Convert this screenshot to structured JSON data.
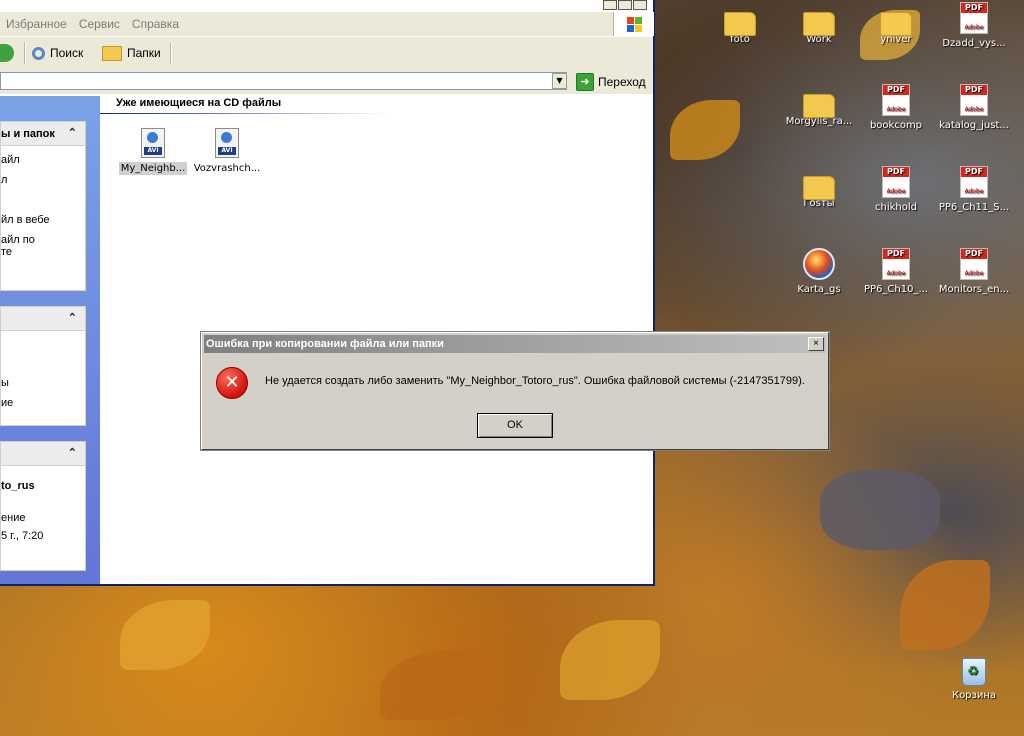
{
  "explorer": {
    "menu": [
      "Избранное",
      "Сервис",
      "Справка"
    ],
    "toolbar": {
      "search": "Поиск",
      "folders": "Папки"
    },
    "go_label": "Переход",
    "panels": [
      {
        "title": "ы и папок",
        "lines": [
          "айл",
          "л",
          "",
          "йл в вебе",
          "айл по",
          "те"
        ]
      },
      {
        "title": "",
        "lines": [
          "",
          "",
          "ы",
          "ие"
        ]
      },
      {
        "title": "",
        "lines": [
          "to_rus",
          "",
          "ение",
          "5 г., 7:20"
        ]
      }
    ],
    "group_title": "Уже имеющиеся на CD файлы",
    "files": [
      {
        "name": "My_Neighb...",
        "selected": true,
        "icon": "avi-file-icon"
      },
      {
        "name": "Vozvrashch...",
        "selected": false,
        "icon": "avi-file-icon"
      }
    ]
  },
  "dialog": {
    "title": "Ошибка при копировании файла или папки",
    "message": "Не удается создать либо заменить \"My_Neighbor_Totoro_rus\".        Ошибка файловой системы (-2147351799).",
    "ok": "OK",
    "close": "×",
    "icon": "error-icon"
  },
  "desktop_icons": [
    {
      "label": "foto",
      "type": "folder"
    },
    {
      "label": "Work",
      "type": "folder"
    },
    {
      "label": "yniver",
      "type": "folder"
    },
    {
      "label": "Dzadd_vys...",
      "type": "pdf"
    },
    {
      "label": "Morgylis_ra...",
      "type": "folder"
    },
    {
      "label": "bookcomp",
      "type": "pdf"
    },
    {
      "label": "katalog_just...",
      "type": "pdf"
    },
    {
      "label": "Гosты",
      "type": "folder"
    },
    {
      "label": "chikhold",
      "type": "pdf"
    },
    {
      "label": "PP6_Ch11_S...",
      "type": "pdf"
    },
    {
      "label": "Karta_gs",
      "type": "app"
    },
    {
      "label": "PP6_Ch10_...",
      "type": "pdf"
    },
    {
      "label": "Monitors_en...",
      "type": "pdf"
    },
    {
      "label": "Корзина",
      "type": "recycle-bin"
    }
  ],
  "colors": {
    "dialog_bg": "#d4d0c8",
    "error_red": "#d0140c",
    "xp_blue": "#0a246a"
  }
}
